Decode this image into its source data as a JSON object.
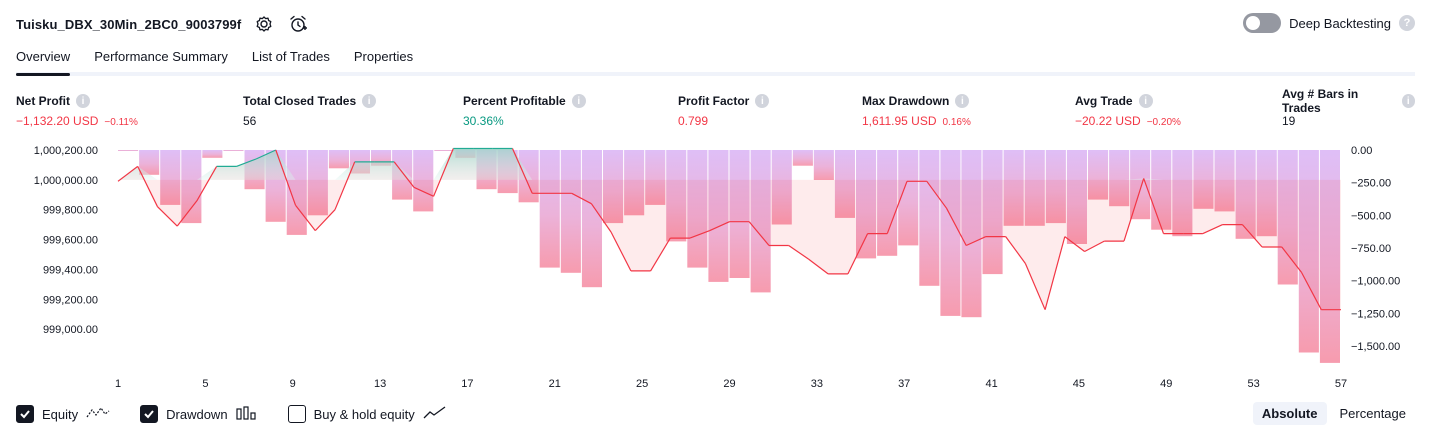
{
  "header": {
    "title": "Tuisku_DBX_30Min_2BC0_9003799f"
  },
  "deep_backtesting": {
    "label": "Deep Backtesting",
    "enabled": false
  },
  "tabs": [
    {
      "label": "Overview",
      "active": true
    },
    {
      "label": "Performance Summary",
      "active": false
    },
    {
      "label": "List of Trades",
      "active": false
    },
    {
      "label": "Properties",
      "active": false
    }
  ],
  "metrics": [
    {
      "label": "Net Profit",
      "value": "−1,132.20 USD",
      "pct": "−0.11%",
      "color": "#f23645"
    },
    {
      "label": "Total Closed Trades",
      "value": "56",
      "pct": "",
      "color": "#131722"
    },
    {
      "label": "Percent Profitable",
      "value": "30.36%",
      "pct": "",
      "color": "#089981"
    },
    {
      "label": "Profit Factor",
      "value": "0.799",
      "pct": "",
      "color": "#f23645"
    },
    {
      "label": "Max Drawdown",
      "value": "1,611.95 USD",
      "pct": "0.16%",
      "color": "#f23645"
    },
    {
      "label": "Avg Trade",
      "value": "−20.22 USD",
      "pct": "−0.20%",
      "color": "#f23645"
    },
    {
      "label": "Avg # Bars in Trades",
      "value": "19",
      "pct": "",
      "color": "#131722"
    }
  ],
  "chart_data": {
    "type": "line",
    "x_ticks": [
      "1",
      "5",
      "9",
      "13",
      "17",
      "21",
      "25",
      "29",
      "33",
      "37",
      "41",
      "45",
      "49",
      "53",
      "57"
    ],
    "left_axis": {
      "ticks": [
        "1,000,200.00",
        "1,000,000.00",
        "999,800.00",
        "999,600.00",
        "999,400.00",
        "999,200.00",
        "999,000.00"
      ],
      "ylim": [
        998800,
        1000200
      ]
    },
    "right_axis": {
      "ticks": [
        "0.00",
        "−250.00",
        "−500.00",
        "−750.00",
        "−1,000.00",
        "−1,250.00",
        "−1,500.00"
      ],
      "ylim": [
        -1600,
        0
      ]
    },
    "series": [
      {
        "name": "Equity",
        "axis": "left",
        "values": [
          999990,
          1000090,
          999820,
          999690,
          999860,
          1000090,
          1000090,
          1000140,
          1000200,
          999830,
          999660,
          999800,
          1000120,
          1000120,
          1000120,
          999950,
          999890,
          1000210,
          1000210,
          1000210,
          1000210,
          999910,
          999910,
          999910,
          999840,
          999650,
          999390,
          999390,
          999610,
          999610,
          999660,
          999720,
          999720,
          999560,
          999560,
          999470,
          999370,
          999370,
          999640,
          999640,
          999990,
          999990,
          999810,
          999560,
          999620,
          999620,
          999440,
          999130,
          999620,
          999520,
          999590,
          999590,
          1000010,
          999640,
          999640,
          999640,
          999700,
          999700,
          999550,
          999550,
          999380,
          999130,
          999130
        ]
      },
      {
        "name": "Drawdown",
        "axis": "right",
        "values": [
          0,
          -190,
          -420,
          -560,
          -60,
          0,
          -300,
          -550,
          -650,
          -500,
          -140,
          -180,
          -120,
          -380,
          -470,
          0,
          -60,
          -300,
          -330,
          -400,
          -900,
          -940,
          -1050,
          -560,
          -500,
          -420,
          -700,
          -900,
          -1010,
          -980,
          -1090,
          -570,
          -120,
          -230,
          -520,
          -830,
          -810,
          -730,
          -1040,
          -1270,
          -1280,
          -950,
          -580,
          -580,
          -560,
          -720,
          -380,
          -430,
          -530,
          -610,
          -660,
          -450,
          -470,
          -680,
          -660,
          -1030,
          -1550,
          -1630
        ]
      }
    ],
    "legend": [
      "Equity",
      "Drawdown",
      "Buy & hold equity"
    ],
    "grid": false
  },
  "footer": {
    "equity_label": "Equity",
    "drawdown_label": "Drawdown",
    "buyhold_label": "Buy & hold equity",
    "equity_checked": true,
    "drawdown_checked": true,
    "buyhold_checked": false,
    "absolute_label": "Absolute",
    "percentage_label": "Percentage",
    "mode": "Absolute"
  },
  "colors": {
    "accent": "#131722",
    "profit": "#089981",
    "loss": "#f23645",
    "drawdown": "#ce93d8"
  }
}
